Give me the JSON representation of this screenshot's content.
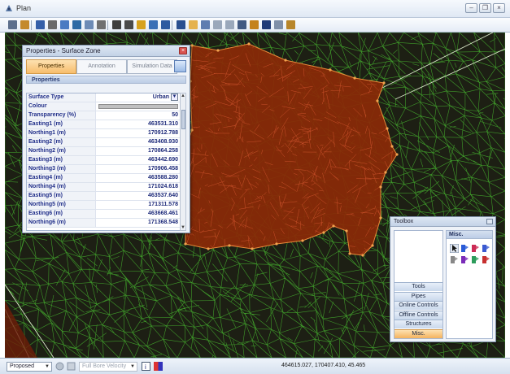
{
  "window": {
    "title": "Plan",
    "controls": [
      "minimize-icon",
      "restore-icon",
      "close-icon"
    ]
  },
  "toolbar": {
    "icons": [
      "arrow-select-icon",
      "properties-icon",
      "cursor-icon",
      "node-icon",
      "measure-icon",
      "layers-icon",
      "pipe-icon",
      "dimension-icon",
      "zoom-in-icon",
      "zoom-out-icon",
      "camera-icon",
      "flow-icon",
      "book-icon",
      "structure-icon",
      "tank-icon",
      "anchor-icon",
      "grid-icon",
      "grid2-icon",
      "building-icon",
      "export-icon",
      "save-icon",
      "document-icon",
      "print-icon"
    ]
  },
  "properties_panel": {
    "title": "Properties - Surface Zone",
    "tabs": [
      {
        "label": "Properties",
        "active": true
      },
      {
        "label": "Annotation",
        "active": false
      },
      {
        "label": "Simulation Data",
        "active": false
      }
    ],
    "section": "Properties",
    "rows": [
      {
        "key": "Surface Type",
        "value": "Urban",
        "type": "dropdown"
      },
      {
        "key": "Colour",
        "value": "",
        "type": "colour"
      },
      {
        "key": "Transparency (%)",
        "value": "50"
      },
      {
        "key": "Easting1 (m)",
        "value": "463531.310"
      },
      {
        "key": "Northing1 (m)",
        "value": "170912.788"
      },
      {
        "key": "Easting2 (m)",
        "value": "463408.930"
      },
      {
        "key": "Northing2 (m)",
        "value": "170864.258"
      },
      {
        "key": "Easting3 (m)",
        "value": "463442.690"
      },
      {
        "key": "Northing3 (m)",
        "value": "170906.458"
      },
      {
        "key": "Easting4 (m)",
        "value": "463588.280"
      },
      {
        "key": "Northing4 (m)",
        "value": "171024.618"
      },
      {
        "key": "Easting5 (m)",
        "value": "463537.640"
      },
      {
        "key": "Northing5 (m)",
        "value": "171311.578"
      },
      {
        "key": "Easting6 (m)",
        "value": "463668.461"
      },
      {
        "key": "Northing6 (m)",
        "value": "171368.548"
      }
    ],
    "colour_swatch": "#c0c0c0"
  },
  "toolbox": {
    "title": "Toolbox",
    "misc_header": "Misc.",
    "categories": [
      {
        "label": "Tools",
        "active": false
      },
      {
        "label": "Pipes",
        "active": false
      },
      {
        "label": "Online Controls",
        "active": false
      },
      {
        "label": "Offline Controls",
        "active": false
      },
      {
        "label": "Structures",
        "active": false
      },
      {
        "label": "Misc.",
        "active": true
      }
    ],
    "misc_icons": [
      "pointer-icon",
      "flag-blue-icon",
      "cube-red-icon",
      "cube-blue-icon",
      "note-icon",
      "flag-purple-icon",
      "flag-green-icon",
      "flag-red-icon"
    ]
  },
  "statusbar": {
    "scenario": "Proposed",
    "velocity": "Full Bore Velocity",
    "coordinates": "464615.027, 170407.410, 45.465"
  },
  "map": {
    "mesh_color": "#3f9a2a",
    "zone_fill": "#8a2a08",
    "zone_stroke": "#e8893a",
    "background": "#1d1f14"
  }
}
